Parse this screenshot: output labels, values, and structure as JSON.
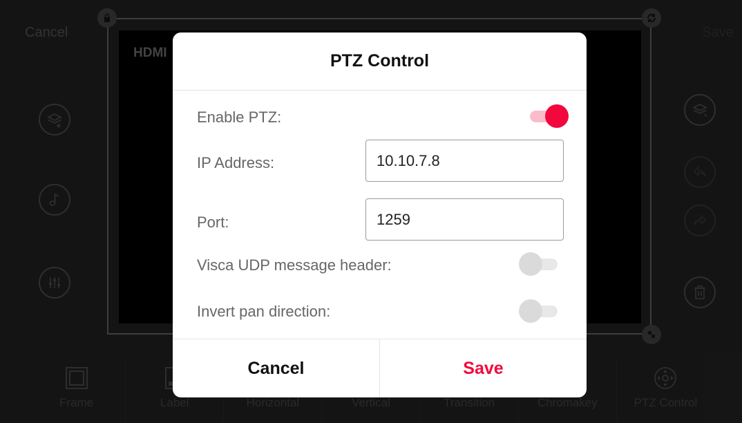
{
  "topbar": {
    "cancel_label": "Cancel",
    "save_label": "Save"
  },
  "canvas": {
    "source_label": "HDMI"
  },
  "tabs": [
    {
      "label": "Frame",
      "icon": "frame-icon"
    },
    {
      "label": "Label",
      "icon": "label-icon"
    },
    {
      "label": "Horizontal",
      "icon": "horizontal-icon"
    },
    {
      "label": "Vertical",
      "icon": "vertical-icon"
    },
    {
      "label": "Transition",
      "icon": "transition-icon"
    },
    {
      "label": "Chromakey",
      "icon": "chromakey-icon"
    },
    {
      "label": "PTZ Control",
      "icon": "ptz-control-icon"
    }
  ],
  "dialog": {
    "title": "PTZ Control",
    "enable_ptz": {
      "label": "Enable PTZ:",
      "on": true
    },
    "ip_address": {
      "label": "IP Address:",
      "value": "10.10.7.8"
    },
    "port": {
      "label": "Port:",
      "value": "1259"
    },
    "visca_udp": {
      "label": "Visca UDP message header:",
      "on": false
    },
    "invert_pan": {
      "label": "Invert pan direction:",
      "on": false
    },
    "cancel_label": "Cancel",
    "save_label": "Save"
  },
  "colors": {
    "accent": "#f2083c",
    "accent_light": "#fbbcca",
    "background": "#262626"
  }
}
